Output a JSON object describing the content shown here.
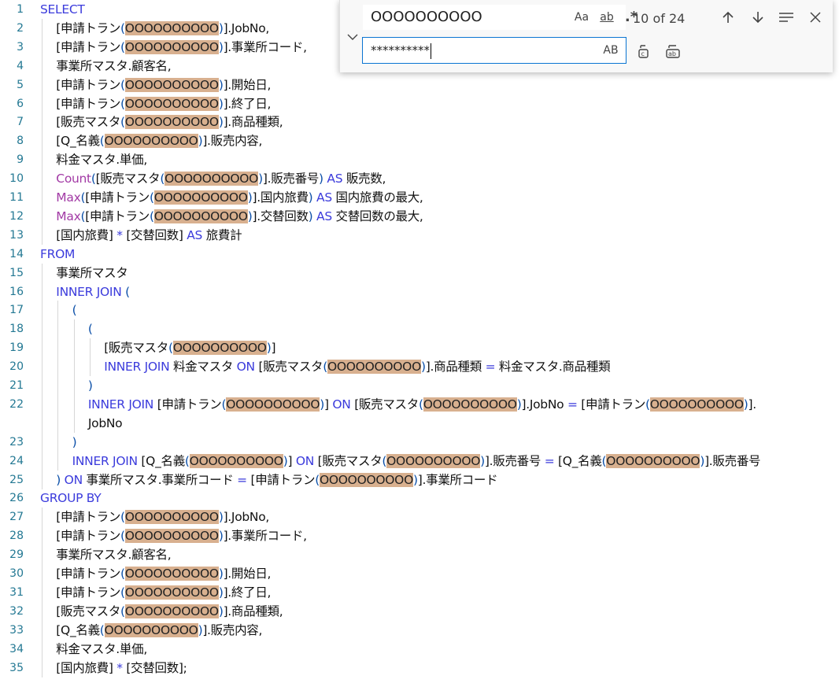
{
  "editor": {
    "lines": [
      {
        "n": "1",
        "indent": 0,
        "tokens": [
          {
            "t": "SELECT",
            "c": "kw"
          }
        ]
      },
      {
        "n": "2",
        "indent": 1,
        "tokens": [
          {
            "t": "[申請トラン",
            "c": ""
          },
          {
            "t": "(",
            "c": "br"
          },
          {
            "t": "OOOOOOOOOO",
            "c": "hl"
          },
          {
            "t": ")",
            "c": "br"
          },
          {
            "t": "].JobNo,",
            "c": ""
          }
        ]
      },
      {
        "n": "3",
        "indent": 1,
        "tokens": [
          {
            "t": "[申請トラン",
            "c": ""
          },
          {
            "t": "(",
            "c": "br"
          },
          {
            "t": "OOOOOOOOOO",
            "c": "hl"
          },
          {
            "t": ")",
            "c": "br"
          },
          {
            "t": "].事業所コード,",
            "c": ""
          }
        ]
      },
      {
        "n": "4",
        "indent": 1,
        "tokens": [
          {
            "t": "事業所マスタ.顧客名,",
            "c": ""
          }
        ]
      },
      {
        "n": "5",
        "indent": 1,
        "tokens": [
          {
            "t": "[申請トラン",
            "c": ""
          },
          {
            "t": "(",
            "c": "br"
          },
          {
            "t": "OOOOOOOOOO",
            "c": "hl"
          },
          {
            "t": ")",
            "c": "br"
          },
          {
            "t": "].開始日,",
            "c": ""
          }
        ]
      },
      {
        "n": "6",
        "indent": 1,
        "tokens": [
          {
            "t": "[申請トラン",
            "c": ""
          },
          {
            "t": "(",
            "c": "br"
          },
          {
            "t": "OOOOOOOOOO",
            "c": "hl"
          },
          {
            "t": ")",
            "c": "br"
          },
          {
            "t": "].終了日,",
            "c": ""
          }
        ]
      },
      {
        "n": "7",
        "indent": 1,
        "tokens": [
          {
            "t": "[販売マスタ",
            "c": ""
          },
          {
            "t": "(",
            "c": "br"
          },
          {
            "t": "OOOOOOOOOO",
            "c": "hl"
          },
          {
            "t": ")",
            "c": "br"
          },
          {
            "t": "].商品種類,",
            "c": ""
          }
        ]
      },
      {
        "n": "8",
        "indent": 1,
        "tokens": [
          {
            "t": "[Q_名義",
            "c": ""
          },
          {
            "t": "(",
            "c": "br"
          },
          {
            "t": "OOOOOOOOOO",
            "c": "hl"
          },
          {
            "t": ")",
            "c": "br"
          },
          {
            "t": "].販売内容,",
            "c": ""
          }
        ]
      },
      {
        "n": "9",
        "indent": 1,
        "tokens": [
          {
            "t": "料金マスタ.単価,",
            "c": ""
          }
        ]
      },
      {
        "n": "10",
        "indent": 1,
        "tokens": [
          {
            "t": "Count",
            "c": "fn"
          },
          {
            "t": "(",
            "c": "br"
          },
          {
            "t": "[販売マスタ",
            "c": ""
          },
          {
            "t": "(",
            "c": "br"
          },
          {
            "t": "OOOOOOOOOO",
            "c": "hl"
          },
          {
            "t": ")",
            "c": "br"
          },
          {
            "t": "].販売番号",
            "c": ""
          },
          {
            "t": ")",
            "c": "br"
          },
          {
            "t": " AS ",
            "c": "kw"
          },
          {
            "t": "販売数,",
            "c": ""
          }
        ]
      },
      {
        "n": "11",
        "indent": 1,
        "tokens": [
          {
            "t": "Max",
            "c": "fn"
          },
          {
            "t": "(",
            "c": "br"
          },
          {
            "t": "[申請トラン",
            "c": ""
          },
          {
            "t": "(",
            "c": "br"
          },
          {
            "t": "OOOOOOOOOO",
            "c": "hl"
          },
          {
            "t": ")",
            "c": "br"
          },
          {
            "t": "].国内旅費",
            "c": ""
          },
          {
            "t": ")",
            "c": "br"
          },
          {
            "t": " AS ",
            "c": "kw"
          },
          {
            "t": "国内旅費の最大,",
            "c": ""
          }
        ]
      },
      {
        "n": "12",
        "indent": 1,
        "tokens": [
          {
            "t": "Max",
            "c": "fn"
          },
          {
            "t": "(",
            "c": "br"
          },
          {
            "t": "[申請トラン",
            "c": ""
          },
          {
            "t": "(",
            "c": "br"
          },
          {
            "t": "OOOOOOOOOO",
            "c": "hl"
          },
          {
            "t": ")",
            "c": "br"
          },
          {
            "t": "].交替回数",
            "c": ""
          },
          {
            "t": ")",
            "c": "br"
          },
          {
            "t": " AS ",
            "c": "kw"
          },
          {
            "t": "交替回数の最大,",
            "c": ""
          }
        ]
      },
      {
        "n": "13",
        "indent": 1,
        "tokens": [
          {
            "t": "[国内旅費]",
            "c": ""
          },
          {
            "t": " * ",
            "c": "op"
          },
          {
            "t": "[交替回数]",
            "c": ""
          },
          {
            "t": " AS ",
            "c": "kw"
          },
          {
            "t": "旅費計",
            "c": ""
          }
        ]
      },
      {
        "n": "14",
        "indent": 0,
        "tokens": [
          {
            "t": "FROM",
            "c": "kw"
          }
        ]
      },
      {
        "n": "15",
        "indent": 1,
        "tokens": [
          {
            "t": "事業所マスタ",
            "c": ""
          }
        ]
      },
      {
        "n": "16",
        "indent": 1,
        "tokens": [
          {
            "t": "INNER JOIN ",
            "c": "kw"
          },
          {
            "t": "(",
            "c": "br"
          }
        ]
      },
      {
        "n": "17",
        "indent": 2,
        "tokens": [
          {
            "t": "(",
            "c": "br"
          }
        ]
      },
      {
        "n": "18",
        "indent": 3,
        "tokens": [
          {
            "t": "(",
            "c": "br"
          }
        ]
      },
      {
        "n": "19",
        "indent": 4,
        "tokens": [
          {
            "t": "[販売マスタ",
            "c": ""
          },
          {
            "t": "(",
            "c": "br"
          },
          {
            "t": "OOOOOOOOOO",
            "c": "hl"
          },
          {
            "t": ")",
            "c": "br"
          },
          {
            "t": "]",
            "c": ""
          }
        ]
      },
      {
        "n": "20",
        "indent": 4,
        "tokens": [
          {
            "t": "INNER JOIN ",
            "c": "kw"
          },
          {
            "t": "料金マスタ ",
            "c": ""
          },
          {
            "t": "ON ",
            "c": "kw"
          },
          {
            "t": "[販売マスタ",
            "c": ""
          },
          {
            "t": "(",
            "c": "br"
          },
          {
            "t": "OOOOOOOOOO",
            "c": "hl"
          },
          {
            "t": ")",
            "c": "br"
          },
          {
            "t": "].商品種類 ",
            "c": ""
          },
          {
            "t": "= ",
            "c": "op"
          },
          {
            "t": "料金マスタ.商品種類",
            "c": ""
          }
        ]
      },
      {
        "n": "21",
        "indent": 3,
        "tokens": [
          {
            "t": ")",
            "c": "br"
          }
        ]
      },
      {
        "n": "22",
        "indent": 3,
        "tokens": [
          {
            "t": "INNER JOIN ",
            "c": "kw"
          },
          {
            "t": "[申請トラン",
            "c": ""
          },
          {
            "t": "(",
            "c": "br"
          },
          {
            "t": "OOOOOOOOOO",
            "c": "hl"
          },
          {
            "t": ")",
            "c": "br"
          },
          {
            "t": "] ",
            "c": ""
          },
          {
            "t": "ON ",
            "c": "kw"
          },
          {
            "t": "[販売マスタ",
            "c": ""
          },
          {
            "t": "(",
            "c": "br"
          },
          {
            "t": "OOOOOOOOOO",
            "c": "hl"
          },
          {
            "t": ")",
            "c": "br"
          },
          {
            "t": "].JobNo ",
            "c": ""
          },
          {
            "t": "= ",
            "c": "op"
          },
          {
            "t": "[申請トラン",
            "c": ""
          },
          {
            "t": "(",
            "c": "br"
          },
          {
            "t": "OOOOOOOOOO",
            "c": "hl"
          },
          {
            "t": ")",
            "c": "br"
          },
          {
            "t": "].",
            "c": ""
          }
        ]
      },
      {
        "n": "",
        "indent": 3,
        "tokens": [
          {
            "t": "JobNo",
            "c": ""
          }
        ]
      },
      {
        "n": "23",
        "indent": 2,
        "tokens": [
          {
            "t": ")",
            "c": "br"
          }
        ]
      },
      {
        "n": "24",
        "indent": 2,
        "tokens": [
          {
            "t": "INNER JOIN ",
            "c": "kw"
          },
          {
            "t": "[Q_名義",
            "c": ""
          },
          {
            "t": "(",
            "c": "br"
          },
          {
            "t": "OOOOOOOOOO",
            "c": "hl"
          },
          {
            "t": ")",
            "c": "br"
          },
          {
            "t": "] ",
            "c": ""
          },
          {
            "t": "ON ",
            "c": "kw"
          },
          {
            "t": "[販売マスタ",
            "c": ""
          },
          {
            "t": "(",
            "c": "br"
          },
          {
            "t": "OOOOOOOOOO",
            "c": "hl"
          },
          {
            "t": ")",
            "c": "br"
          },
          {
            "t": "].販売番号 ",
            "c": ""
          },
          {
            "t": "= ",
            "c": "op"
          },
          {
            "t": "[Q_名義",
            "c": ""
          },
          {
            "t": "(",
            "c": "br"
          },
          {
            "t": "OOOOOOOOOO",
            "c": "hl"
          },
          {
            "t": ")",
            "c": "br"
          },
          {
            "t": "].販売番号",
            "c": ""
          }
        ]
      },
      {
        "n": "25",
        "indent": 1,
        "tokens": [
          {
            "t": ") ",
            "c": "br"
          },
          {
            "t": "ON ",
            "c": "kw"
          },
          {
            "t": "事業所マスタ.事業所コード ",
            "c": ""
          },
          {
            "t": "= ",
            "c": "op"
          },
          {
            "t": "[申請トラン",
            "c": ""
          },
          {
            "t": "(",
            "c": "br"
          },
          {
            "t": "OOOOOOOOOO",
            "c": "hl"
          },
          {
            "t": ")",
            "c": "br"
          },
          {
            "t": "].事業所コード",
            "c": ""
          }
        ]
      },
      {
        "n": "26",
        "indent": 0,
        "tokens": [
          {
            "t": "GROUP BY",
            "c": "kw"
          }
        ]
      },
      {
        "n": "27",
        "indent": 1,
        "tokens": [
          {
            "t": "[申請トラン",
            "c": ""
          },
          {
            "t": "(",
            "c": "br"
          },
          {
            "t": "OOOOOOOOOO",
            "c": "hl"
          },
          {
            "t": ")",
            "c": "br"
          },
          {
            "t": "].JobNo,",
            "c": ""
          }
        ]
      },
      {
        "n": "28",
        "indent": 1,
        "tokens": [
          {
            "t": "[申請トラン",
            "c": ""
          },
          {
            "t": "(",
            "c": "br"
          },
          {
            "t": "OOOOOOOOOO",
            "c": "hl"
          },
          {
            "t": ")",
            "c": "br"
          },
          {
            "t": "].事業所コード,",
            "c": ""
          }
        ]
      },
      {
        "n": "29",
        "indent": 1,
        "tokens": [
          {
            "t": "事業所マスタ.顧客名,",
            "c": ""
          }
        ]
      },
      {
        "n": "30",
        "indent": 1,
        "tokens": [
          {
            "t": "[申請トラン",
            "c": ""
          },
          {
            "t": "(",
            "c": "br"
          },
          {
            "t": "OOOOOOOOOO",
            "c": "hl"
          },
          {
            "t": ")",
            "c": "br"
          },
          {
            "t": "].開始日,",
            "c": ""
          }
        ]
      },
      {
        "n": "31",
        "indent": 1,
        "tokens": [
          {
            "t": "[申請トラン",
            "c": ""
          },
          {
            "t": "(",
            "c": "br"
          },
          {
            "t": "OOOOOOOOOO",
            "c": "hl"
          },
          {
            "t": ")",
            "c": "br"
          },
          {
            "t": "].終了日,",
            "c": ""
          }
        ]
      },
      {
        "n": "32",
        "indent": 1,
        "tokens": [
          {
            "t": "[販売マスタ",
            "c": ""
          },
          {
            "t": "(",
            "c": "br"
          },
          {
            "t": "OOOOOOOOOO",
            "c": "hl"
          },
          {
            "t": ")",
            "c": "br"
          },
          {
            "t": "].商品種類,",
            "c": ""
          }
        ]
      },
      {
        "n": "33",
        "indent": 1,
        "tokens": [
          {
            "t": "[Q_名義",
            "c": ""
          },
          {
            "t": "(",
            "c": "br"
          },
          {
            "t": "OOOOOOOOOO",
            "c": "hl"
          },
          {
            "t": ")",
            "c": "br"
          },
          {
            "t": "].販売内容,",
            "c": ""
          }
        ]
      },
      {
        "n": "34",
        "indent": 1,
        "tokens": [
          {
            "t": "料金マスタ.単価,",
            "c": ""
          }
        ]
      },
      {
        "n": "35",
        "indent": 1,
        "tokens": [
          {
            "t": "[国内旅費]",
            "c": ""
          },
          {
            "t": " * ",
            "c": "op"
          },
          {
            "t": "[交替回数];",
            "c": ""
          }
        ]
      }
    ]
  },
  "find_widget": {
    "toggle_replace_icon": "chevron-down-icon",
    "find_value": "OOOOOOOOOO",
    "match_case_label": "Aa",
    "whole_word_label": "ab",
    "regex_label": ".*",
    "match_count": "10 of 24",
    "prev_icon": "arrow-up-icon",
    "next_icon": "arrow-down-icon",
    "selection_icon": "find-in-selection-icon",
    "close_icon": "close-icon",
    "replace_value": "**********",
    "preserve_case_label": "AB",
    "replace_icon": "replace-icon",
    "replace_all_icon": "replace-all-icon"
  },
  "colors": {
    "keyword": "#3b3bdc",
    "function": "#a23aa5",
    "highlight": "#d8b08f",
    "line_number": "#237893",
    "focus_border": "#0a74d2"
  }
}
